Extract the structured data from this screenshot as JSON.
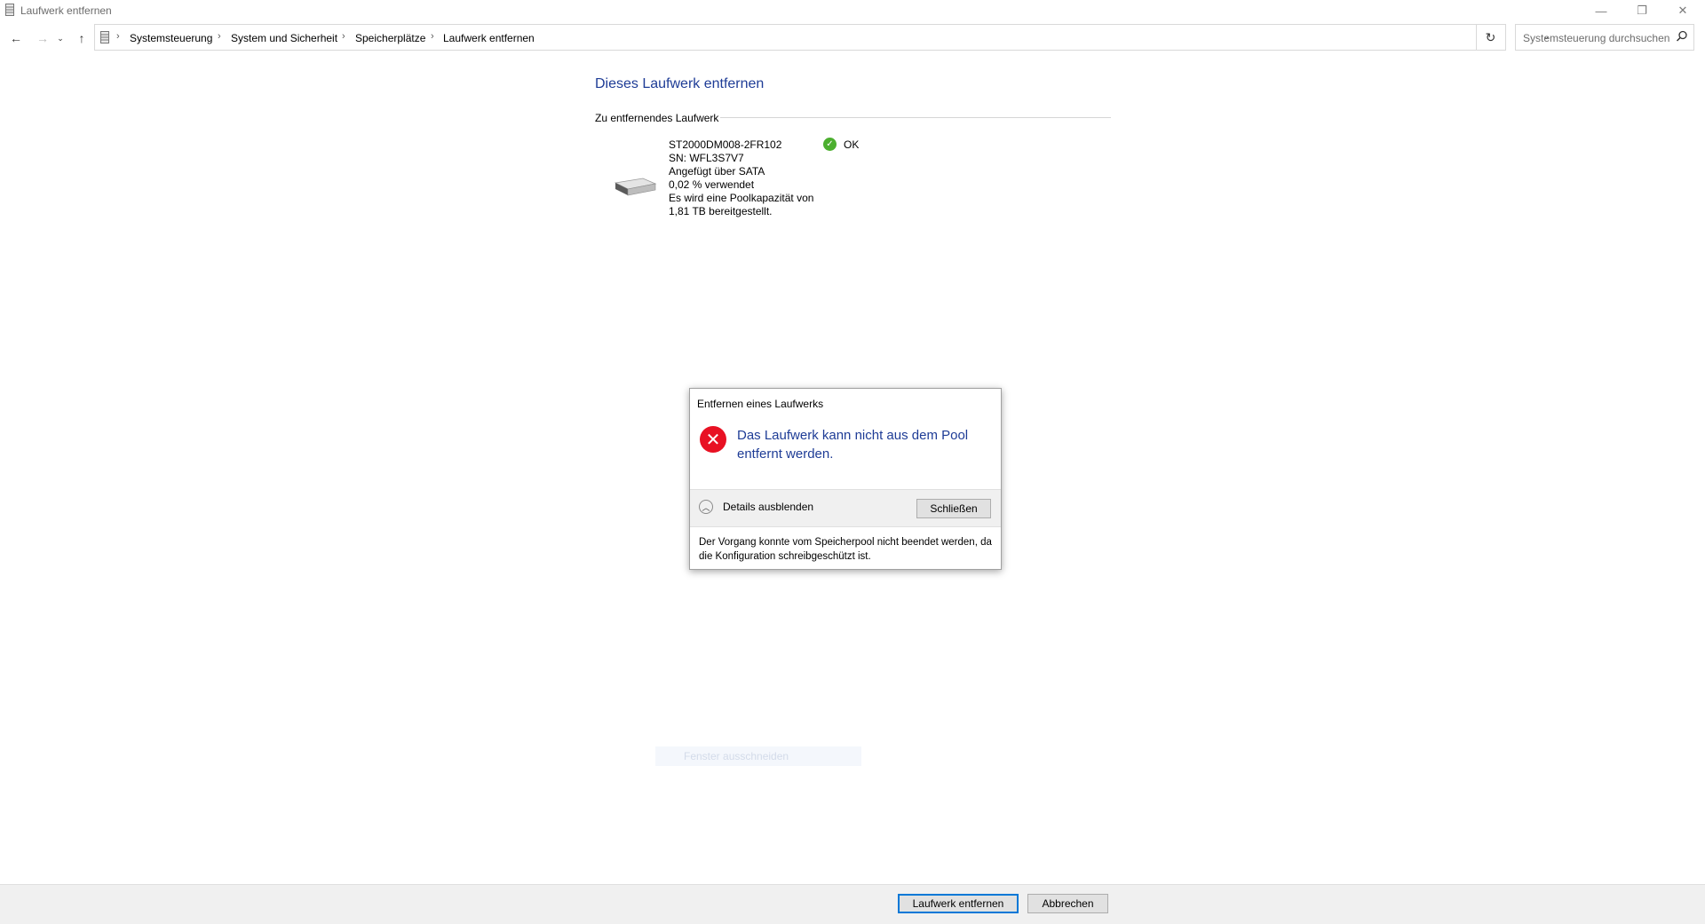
{
  "window": {
    "title": "Laufwerk entfernen",
    "controls": {
      "minimize": "—",
      "maximize": "❐",
      "close": "✕"
    }
  },
  "nav": {
    "back_icon": "arrow-left-icon",
    "forward_icon": "arrow-right-icon",
    "recent_icon": "chevron-down-icon",
    "up_icon": "arrow-up-icon",
    "breadcrumb": [
      "Systemsteuerung",
      "System und Sicherheit",
      "Speicherplätze",
      "Laufwerk entfernen"
    ],
    "search_placeholder": "Systemsteuerung durchsuchen"
  },
  "main": {
    "heading": "Dieses Laufwerk entfernen",
    "group_label": "Zu entfernendes Laufwerk",
    "drive": {
      "model": "ST2000DM008-2FR102",
      "serial": "SN: WFL3S7V7",
      "connection": "Angefügt über SATA",
      "usage": "0,02 % verwendet",
      "capacity_line1": "Es wird eine Poolkapazität von",
      "capacity_line2": "1,81 TB bereitgestellt.",
      "status": "OK"
    },
    "ghost_item": "Fenster ausschneiden"
  },
  "dialog": {
    "title": "Entfernen eines Laufwerks",
    "message": "Das Laufwerk kann nicht aus dem Pool entfernt werden.",
    "details_toggle": "Details ausblenden",
    "close_button": "Schließen",
    "details": "Der Vorgang konnte vom Speicherpool nicht beendet werden, da die Konfiguration schreibgeschützt ist."
  },
  "footer": {
    "primary_button": "Laufwerk entfernen",
    "cancel_button": "Abbrechen"
  },
  "colors": {
    "heading_blue": "#1e3c96",
    "error_red": "#e81123",
    "ok_green": "#4caf2f",
    "focus_border": "#0078d7"
  }
}
